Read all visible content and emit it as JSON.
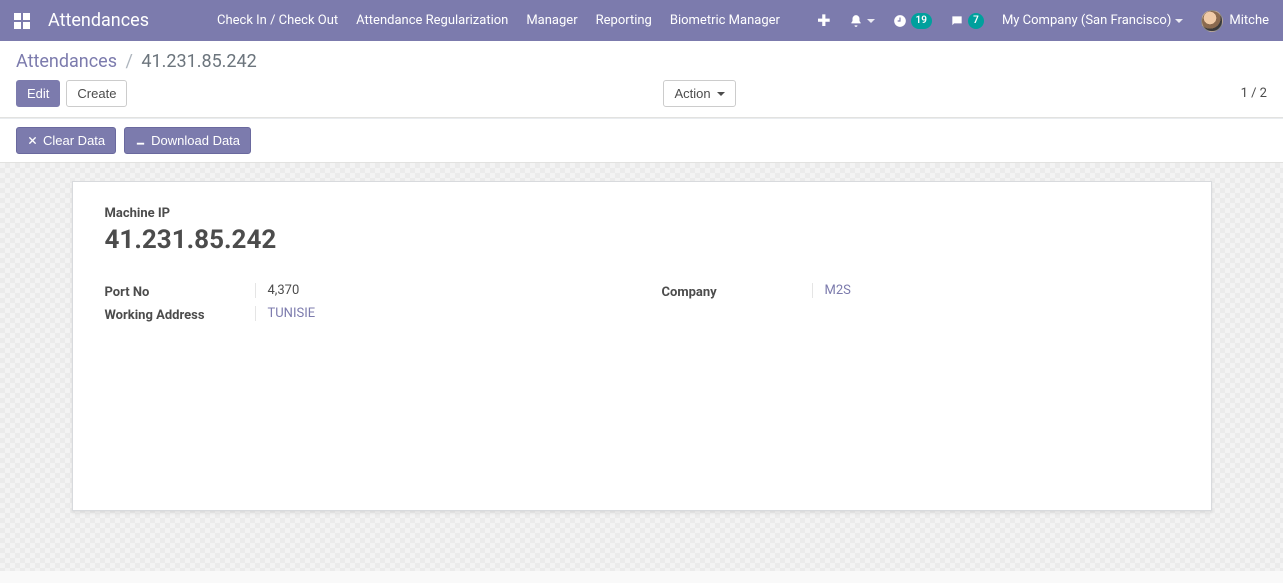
{
  "nav": {
    "brand": "Attendances",
    "items": [
      "Check In / Check Out",
      "Attendance Regularization",
      "Manager",
      "Reporting",
      "Biometric Manager"
    ],
    "activity_count": "19",
    "message_count": "7",
    "company": "My Company (San Francisco)",
    "username": "Mitche"
  },
  "breadcrumb": {
    "parent": "Attendances",
    "current": "41.231.85.242"
  },
  "toolbar": {
    "edit": "Edit",
    "create": "Create",
    "action": "Action",
    "pager": "1 / 2"
  },
  "statusbar": {
    "clear_data": "Clear Data",
    "download_data": "Download Data"
  },
  "form": {
    "title_label": "Machine IP",
    "title_value": "41.231.85.242",
    "port_label": "Port No",
    "port_value": "4,370",
    "address_label": "Working Address",
    "address_value": "TUNISIE",
    "company_label": "Company",
    "company_value": "M2S"
  }
}
